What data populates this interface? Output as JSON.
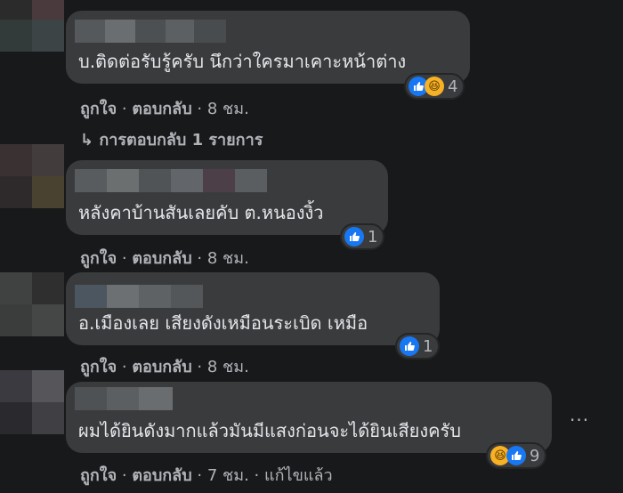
{
  "comments": [
    {
      "text": "บ.ติดต่อรับรู้ครับ นึกว่าใครมาเคาะหน้าต่าง",
      "reaction_count": "4",
      "like": "ถูกใจ",
      "sep1": "·",
      "reply": "ตอบกลับ",
      "sep2": "·",
      "time": "8 ชม.",
      "replies_link": "↳ การตอบกลับ 1 รายการ"
    },
    {
      "text": "หลังคาบ้านสันเลยคับ ต.หนองงิ้ว",
      "reaction_count": "1",
      "like": "ถูกใจ",
      "sep1": "·",
      "reply": "ตอบกลับ",
      "sep2": "·",
      "time": "8 ชม."
    },
    {
      "text": "อ.เมืองเลย เสียงดังเหมือนระเบิด เหมือ",
      "reaction_count": "1",
      "like": "ถูกใจ",
      "sep1": "·",
      "reply": "ตอบกลับ",
      "sep2": "·",
      "time": "8 ชม."
    },
    {
      "text": "ผมได้ยินดังมากแล้วมันมีแสงก่อนจะได้ยินเสียงครับ",
      "reaction_count": "9",
      "like": "ถูกใจ",
      "sep1": "·",
      "reply": "ตอบกลับ",
      "sep2": "·",
      "time": "7 ชม.",
      "sep3": "·",
      "edited": "แก้ไขแล้ว",
      "more": "···"
    }
  ],
  "colors": {
    "background": "#18191a",
    "bubble": "#3a3b3c",
    "like_blue": "#1877f2",
    "haha_yellow": "#f7b125",
    "secondary_text": "#b0b3b8"
  },
  "icons": [
    "like-icon",
    "haha-icon",
    "reply-arrow-icon",
    "more-options-icon"
  ]
}
